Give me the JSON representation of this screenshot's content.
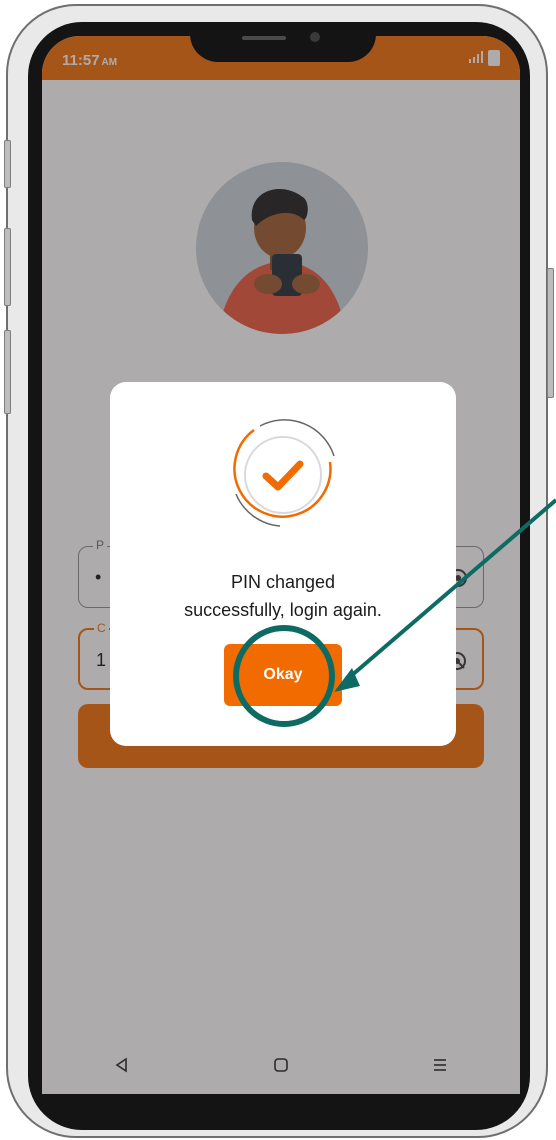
{
  "status_bar": {
    "time": "11:57",
    "am_pm": "AM",
    "signal_icon": "signal-icon",
    "battery_icon": "battery-icon"
  },
  "form": {
    "pin_label": "P",
    "pin_value": "•",
    "confirm_label": "C",
    "confirm_value": "1"
  },
  "dialog": {
    "icon": "check-circle-icon",
    "message_line1": "PIN changed",
    "message_line2": "successfully, login again.",
    "okay_label": "Okay"
  },
  "nav": {
    "back_icon": "back-triangle-icon",
    "home_icon": "home-square-icon",
    "menu_icon": "menu-lines-icon"
  },
  "colors": {
    "accent": "#f26b00",
    "annotation": "#0e6b64",
    "overlay": "#aca8ab"
  }
}
